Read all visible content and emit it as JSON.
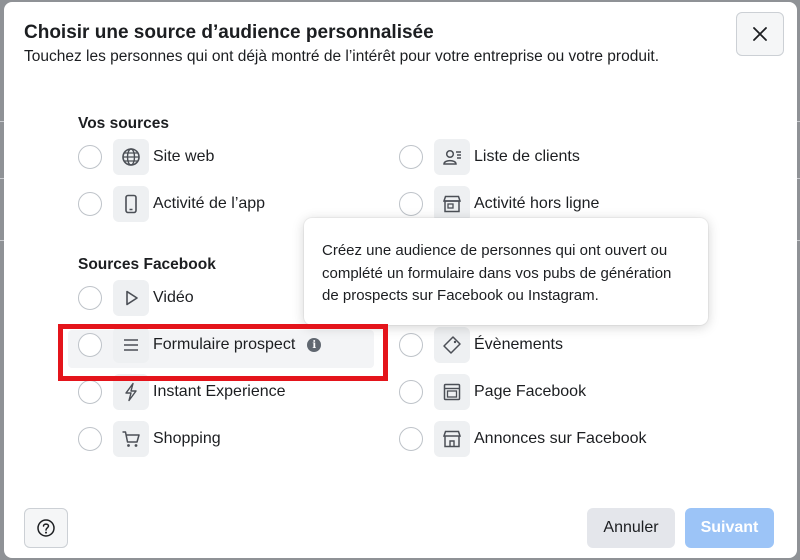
{
  "dialog": {
    "title": "Choisir une source d’audience personnalisée",
    "subtitle": "Touchez les personnes qui ont déjà montré de l’intérêt pour votre entreprise ou votre produit.",
    "close_icon": "close-icon"
  },
  "your_sources": {
    "heading": "Vos sources",
    "items": [
      {
        "label": "Site web",
        "icon": "globe-icon"
      },
      {
        "label": "Liste de clients",
        "icon": "customer-list-icon"
      },
      {
        "label": "Activité de l’app",
        "icon": "mobile-app-icon"
      },
      {
        "label": "Activité hors ligne",
        "icon": "offline-store-icon"
      }
    ]
  },
  "facebook_sources": {
    "heading": "Sources Facebook",
    "items": [
      {
        "label": "Vidéo",
        "icon": "play-icon"
      },
      {
        "label": "Formulaire prospect",
        "icon": "form-lines-icon",
        "info_icon": "info-icon",
        "highlighted": true
      },
      {
        "label": "Évènements",
        "icon": "ticket-icon"
      },
      {
        "label": "Instant Experience",
        "icon": "lightning-icon"
      },
      {
        "label": "Page Facebook",
        "icon": "page-icon"
      },
      {
        "label": "Shopping",
        "icon": "cart-icon"
      },
      {
        "label": "Annonces sur Facebook",
        "icon": "storefront-icon"
      }
    ]
  },
  "tooltip": {
    "text": "Créez une audience de personnes qui ont ouvert ou complété un formulaire dans vos pubs de génération de prospects sur Facebook ou Instagram."
  },
  "footer": {
    "help_icon": "help-icon",
    "cancel_label": "Annuler",
    "next_label": "Suivant"
  },
  "colors": {
    "highlight": "#e4141b",
    "next_disabled": "#9cc4f7",
    "cancel_bg": "#e4e6eb"
  }
}
